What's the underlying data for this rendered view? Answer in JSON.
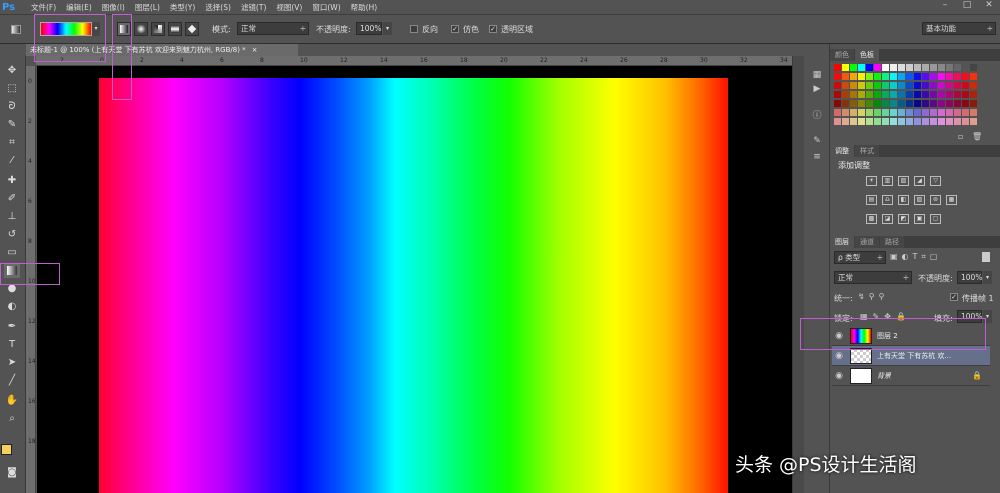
{
  "app": {
    "logo": "Ps"
  },
  "menu": [
    "文件(F)",
    "编辑(E)",
    "图像(I)",
    "图层(L)",
    "类型(Y)",
    "选择(S)",
    "滤镜(T)",
    "视图(V)",
    "窗口(W)",
    "帮助(H)"
  ],
  "window_buttons": [
    "–",
    "□",
    "✕"
  ],
  "options": {
    "mode_label": "模式:",
    "mode_value": "正常",
    "opacity_label": "不透明度:",
    "opacity_value": "100%",
    "reverse_label": "反向",
    "dither_label": "仿色",
    "transparency_label": "透明区域",
    "workspace": "基本功能"
  },
  "document": {
    "tab_title": "未标题-1 @ 100% (上有天堂 下有苏杭 欢迎来到魅力杭州, RGB/8) *",
    "close": "×"
  },
  "ruler_h": [
    "2",
    "0",
    "2",
    "4",
    "6",
    "8",
    "10",
    "12",
    "14",
    "16",
    "18",
    "20",
    "22",
    "24",
    "26",
    "28",
    "30",
    "32",
    "34"
  ],
  "ruler_v": [
    "0",
    "2",
    "4",
    "6",
    "8",
    "10",
    "12",
    "14",
    "16",
    "18"
  ],
  "panels": {
    "swatch_tabs": [
      "颜色",
      "色板"
    ],
    "adjust_tabs": [
      "调整",
      "样式"
    ],
    "adjust_title": "添加调整",
    "layer_tabs": [
      "图层",
      "通道",
      "路径"
    ],
    "filter_kind": "ρ 类型",
    "blend_mode": "正常",
    "opacity_label": "不透明度:",
    "opacity_value": "100%",
    "unify_label": "统一:",
    "propagate_label": "传播帧 1",
    "lock_label": "锁定:",
    "fill_label": "填充:",
    "fill_value": "100%",
    "layers": [
      {
        "name": "图层 2"
      },
      {
        "name": "上有天堂 下有苏杭 欢..."
      },
      {
        "name": "背景"
      }
    ]
  },
  "watermark": "头条 @PS设计生活阁",
  "colors": {
    "fg": "#f5d060",
    "bg": "#e02020"
  }
}
